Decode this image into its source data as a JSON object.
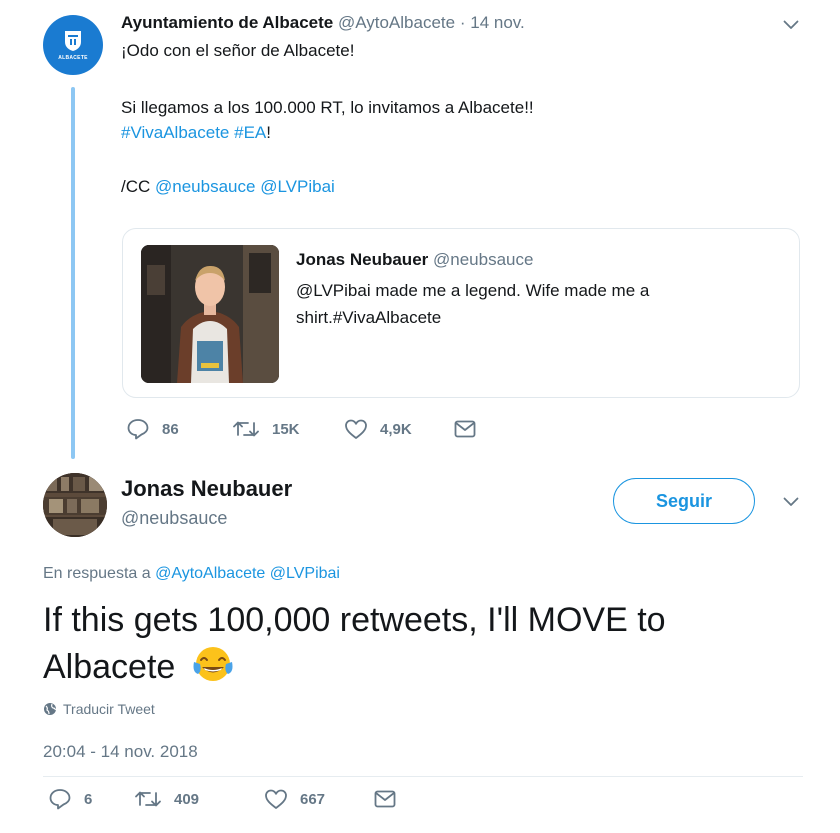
{
  "tweet1": {
    "author_name": "Ayuntamiento de Albacete",
    "author_handle": "@AytoAlbacete",
    "separator": "·",
    "date": "14 nov.",
    "avatar_text": "ALBACETE",
    "line1": "¡Odo con el señor de Albacete!",
    "line2": "Si llegamos a los 100.000 RT, lo invitamos a Albacete!!",
    "hashtag1": "#VivaAlbacete",
    "hashtag2": "#EA",
    "exclaim": "!",
    "cc_prefix": "/CC",
    "mention1": "@neubsauce",
    "mention2": "@LVPibai",
    "quote": {
      "author_name": "Jonas Neubauer",
      "author_handle": "@neubsauce",
      "text": "@LVPibai made me a legend. Wife made me a shirt.#VivaAlbacete",
      "shirt_text": "VIVA ALBACETE"
    },
    "actions": {
      "replies": "86",
      "retweets": "15K",
      "likes": "4,9K"
    }
  },
  "tweet2": {
    "author_name": "Jonas Neubauer",
    "author_handle": "@neubsauce",
    "follow_label": "Seguir",
    "reply_prefix": "En respuesta a",
    "reply_mention1": "@AytoAlbacete",
    "reply_mention2": "@LVPibai",
    "text": "If this gets 100,000 retweets, I'll MOVE to Albacete",
    "translate_label": "Traducir Tweet",
    "timestamp": "20:04 - 14 nov. 2018",
    "actions": {
      "replies": "6",
      "retweets": "409",
      "likes": "667"
    }
  },
  "colors": {
    "link": "#1b95e0",
    "thread_line": "#8dc7f3",
    "muted": "#657786",
    "avatar_blue": "#1a7bd1"
  },
  "icons": [
    "reply-icon",
    "retweet-icon",
    "like-icon",
    "message-icon",
    "chevron-down-icon",
    "globe-icon",
    "tears-of-joy-emoji"
  ]
}
